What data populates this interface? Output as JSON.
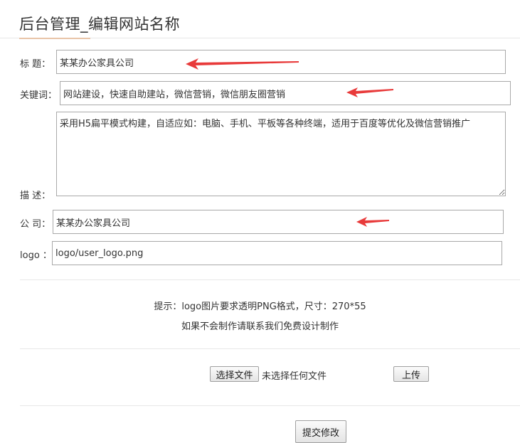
{
  "header": {
    "title": "后台管理_编辑网站名称"
  },
  "form": {
    "title": {
      "label": "标 题：",
      "value": "某某办公家具公司"
    },
    "keywords": {
      "label": "关键词：",
      "value": "网站建设，快速自助建站，微信营销，微信朋友圈营销"
    },
    "description": {
      "label": "描 述：",
      "value": "采用H5扁平模式构建，自适应如：电脑、手机、平板等各种终端，适用于百度等优化及微信营销推广"
    },
    "company": {
      "label": "公 司：",
      "value": "某某办公家具公司"
    },
    "logo": {
      "label": "logo ：",
      "value": "logo/user_logo.png"
    }
  },
  "hint": {
    "line1": "提示：logo图片要求透明PNG格式，尺寸：270*55",
    "line2": "如果不会制作请联系我们免费设计制作"
  },
  "upload": {
    "choose_label": "选择文件",
    "status": "未选择任何文件",
    "upload_label": "上传"
  },
  "submit_label": "提交修改",
  "colors": {
    "arrow": "#e83a3a",
    "accent_rule": "#e8c4a8"
  }
}
